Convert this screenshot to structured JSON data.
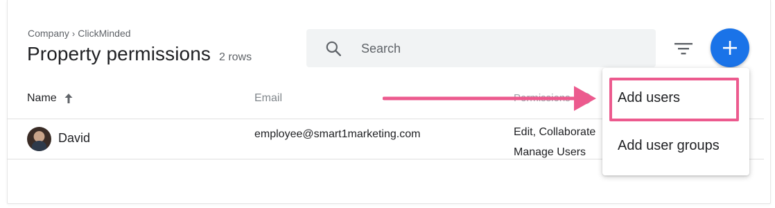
{
  "breadcrumb": {
    "parent": "Company",
    "separator": "›",
    "current": "ClickMinded"
  },
  "header": {
    "title": "Property permissions",
    "row_count": "2 rows"
  },
  "search": {
    "placeholder": "Search",
    "value": ""
  },
  "icons": {
    "search": "search-icon",
    "filter": "filter-icon",
    "add": "plus-icon",
    "sort": "arrow-up-icon",
    "info": "info-icon"
  },
  "table": {
    "columns": {
      "name": "Name",
      "email": "Email",
      "permissions": "Permissions"
    },
    "rows": [
      {
        "name": "David",
        "email": "employee@smart1marketing.com",
        "permissions_line1": "Edit, Collaborate",
        "permissions_line2": "Manage Users"
      }
    ]
  },
  "add_menu": {
    "items": [
      "Add users",
      "Add user groups"
    ]
  },
  "colors": {
    "accent": "#1a73e8",
    "annotation": "#ec5a8e",
    "search_bg": "#f1f3f4"
  }
}
